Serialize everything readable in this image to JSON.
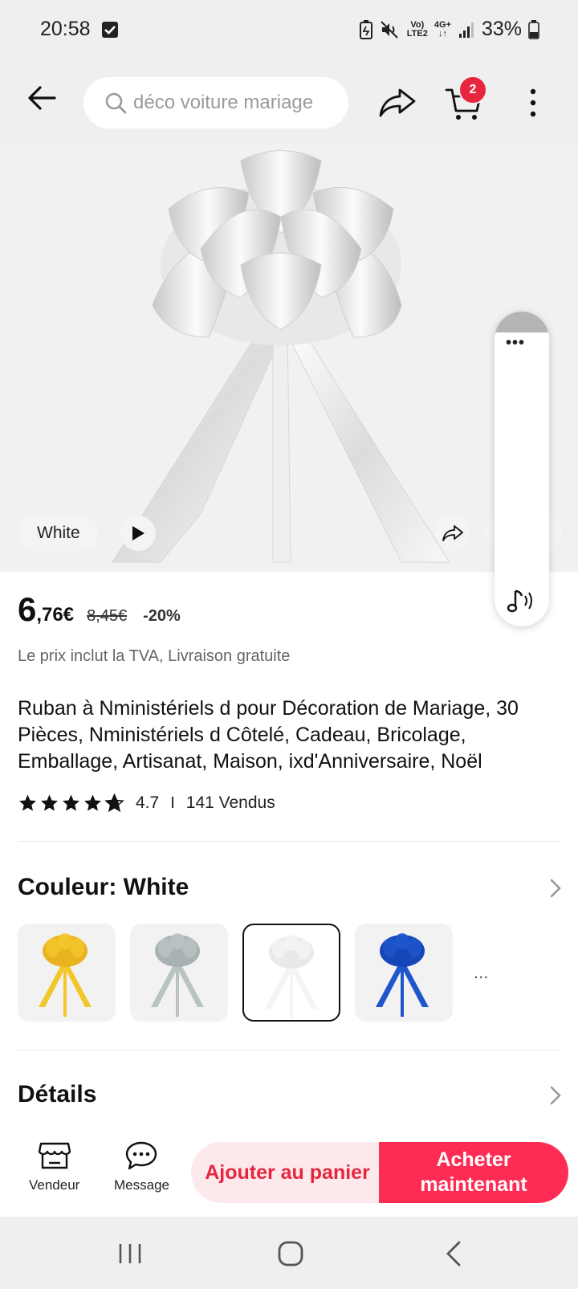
{
  "status_bar": {
    "time": "20:58",
    "network_top": "Vo)",
    "network_bottom": "LTE2",
    "signal_top": "4G+",
    "signal_bottom": "↓↑",
    "battery": "33%"
  },
  "toolbar": {
    "search_placeholder": "déco voiture mariage",
    "cart_count": "2"
  },
  "hero": {
    "variant_chip": "White"
  },
  "price": {
    "integer": "6",
    "decimal": ",76€",
    "original": "8,45€",
    "discount": "-20%",
    "note": "Le prix inclut la TVA, Livraison gratuite"
  },
  "product": {
    "title": "Ruban à Nministériels d pour Décoration de Mariage, 30 Pièces, Nministériels d Côtelé, Cadeau, Bricolage, Emballage, Artisanat, Maison, ixd'Anniversaire, Noël",
    "rating": "4.7",
    "rating_separator": "I",
    "sold": "141 Vendus",
    "stars": 4.7
  },
  "color": {
    "title": "Couleur: White",
    "options": [
      {
        "name": "gold",
        "color": "#e9b320",
        "ribbon": "#f3c72c"
      },
      {
        "name": "silver-grey",
        "color": "#a9b2b2",
        "ribbon": "#b9c3c3"
      },
      {
        "name": "white",
        "color": "#e9e9e9",
        "ribbon": "#f4f4f4"
      },
      {
        "name": "royal-blue",
        "color": "#1646b8",
        "ribbon": "#1e56cc"
      }
    ],
    "more": "..."
  },
  "details": {
    "title": "Détails"
  },
  "bottom_bar": {
    "vendor_label": "Vendeur",
    "message_label": "Message",
    "add_to_cart": "Ajouter au panier",
    "buy_now": "Acheter maintenant"
  },
  "colors": {
    "accent": "#fe2b54",
    "badge": "#e8253f",
    "cart_button_bg": "#fde9ec"
  }
}
